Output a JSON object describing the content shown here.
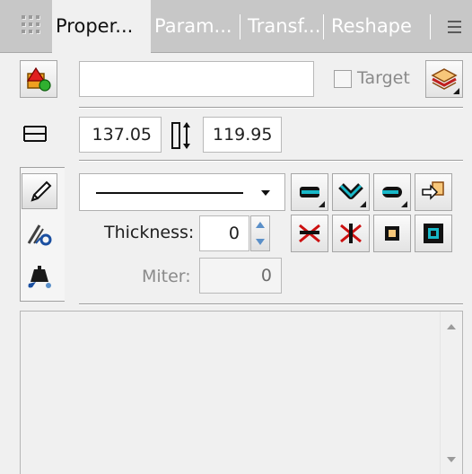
{
  "tabs": [
    {
      "label": "Proper...",
      "active": true
    },
    {
      "label": "Param...",
      "active": false
    },
    {
      "label": "Transf...",
      "active": false
    },
    {
      "label": "Reshape",
      "active": false
    }
  ],
  "tab_menu_icon": "panel-menu-icon",
  "name_row": {
    "object_icon": "shape-object-icon",
    "name_value": "",
    "target_label": "Target",
    "target_checked": false,
    "layer_icon": "layer-stack-icon"
  },
  "size_row": {
    "width_icon": "width-icon",
    "width_value": "137.05",
    "height_icon": "height-icon",
    "height_value": "119.95"
  },
  "stroke": {
    "tools": [
      "pen-icon",
      "brush-style-icon",
      "fill-bucket-icon"
    ],
    "line_style": "solid",
    "cap_buttons": [
      "butt-cap-icon",
      "round-join-icon",
      "round-cap-icon",
      "stroke-import-icon"
    ],
    "thickness_label": "Thickness:",
    "thickness_value": "0",
    "join_buttons": [
      "miter-join-icon",
      "bevel-join-icon",
      "inside-stroke-icon",
      "outside-stroke-icon"
    ],
    "miter_label": "Miter:",
    "miter_value": "0"
  },
  "colors": {
    "tabbar": "#c7c7c7",
    "panel": "#f0f0f0",
    "accent_red": "#cc1010",
    "accent_cyan": "#18b8c8",
    "accent_blue": "#1a4fa0"
  }
}
